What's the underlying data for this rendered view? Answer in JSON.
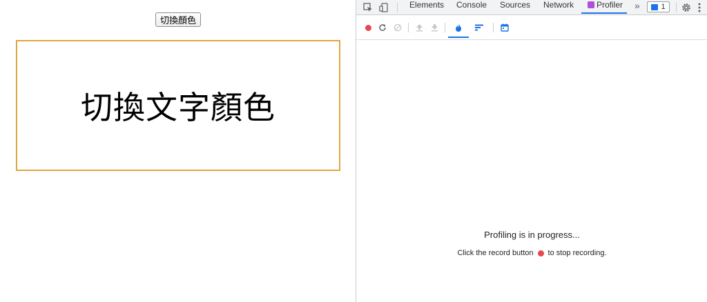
{
  "page": {
    "button_label": "切換顏色",
    "box_text": "切換文字顏色"
  },
  "devtools": {
    "tabs": [
      {
        "label": "Elements"
      },
      {
        "label": "Console"
      },
      {
        "label": "Sources"
      },
      {
        "label": "Network"
      },
      {
        "label": "Profiler",
        "active": true
      }
    ],
    "more_tabs_glyph": "»",
    "message_badge_count": "1",
    "toolbar_icons": [
      "record-icon",
      "reload-icon",
      "clear-icon",
      "upload-icon",
      "download-icon",
      "flamegraph-icon",
      "ranked-icon",
      "timeline-icon"
    ],
    "status": {
      "title": "Profiling is in progress...",
      "sub_before": "Click the record button",
      "sub_after": "to stop recording."
    }
  },
  "colors": {
    "accent": "#1a73e8",
    "record": "#e5484d",
    "box_border": "#dfa53e"
  }
}
